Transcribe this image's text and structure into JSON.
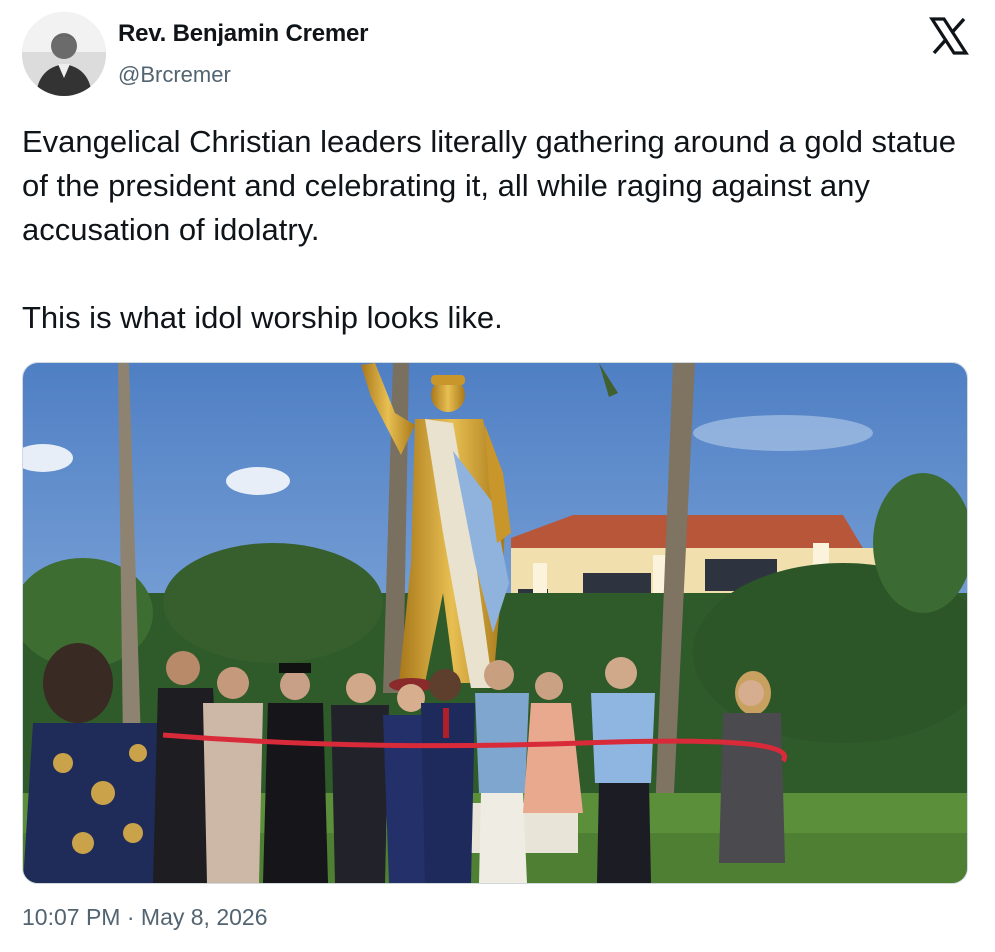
{
  "author": {
    "name": "Rev. Benjamin Cremer",
    "handle": "@Brcremer"
  },
  "platform_icon": "x-logo-icon",
  "tweet": {
    "paragraphs": [
      "Evangelical Christian leaders literally gathering around a gold statue of the president and celebrating it, all while raging against any accusation of idolatry.",
      "This is what idol worship looks like."
    ]
  },
  "timestamp": {
    "time": "10:07 PM",
    "separator": "·",
    "date": "May 8, 2026"
  },
  "colors": {
    "text": "#0f1419",
    "muted": "#536471",
    "border": "#cfd9de",
    "statue_gold": "#d4a52a",
    "ribbon": "#d92a3a"
  }
}
